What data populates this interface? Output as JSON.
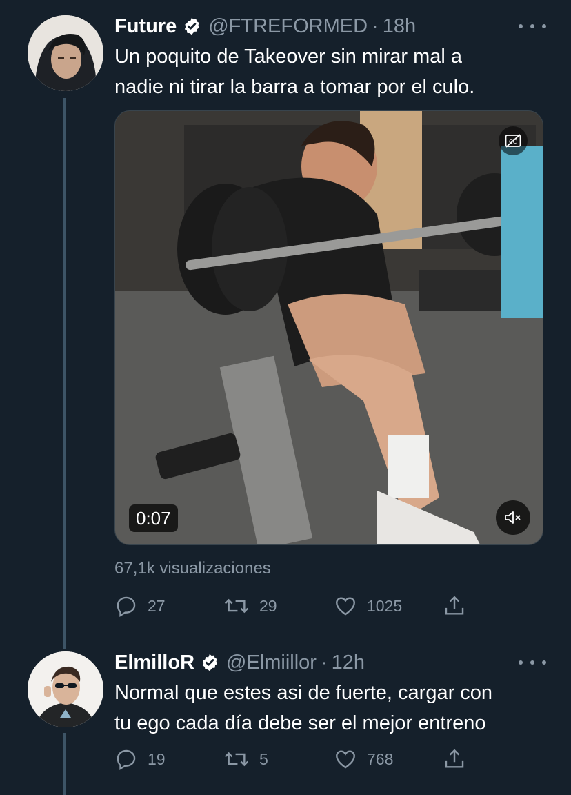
{
  "tweets": [
    {
      "display_name": "Future",
      "handle": "@FTREFORMED",
      "separator": "·",
      "time": "18h",
      "text_lines": [
        "Un poquito de Takeover sin mirar mal a",
        "nadie ni tirar la barra a tomar por el culo."
      ],
      "media": {
        "type": "video",
        "duration": "0:07",
        "icons": [
          "closed-captions-off-icon",
          "mute-icon"
        ]
      },
      "views": "67,1k visualizaciones",
      "actions": {
        "reply_count": "27",
        "retweet_count": "29",
        "like_count": "1025"
      }
    },
    {
      "display_name": "ElmilloR",
      "handle": "@Elmiillor",
      "separator": "·",
      "time": "12h",
      "text_lines": [
        "Normal que estes asi de fuerte, cargar con",
        "tu ego cada día debe ser el mejor entreno"
      ],
      "actions": {
        "reply_count": "19",
        "retweet_count": "5",
        "like_count": "768"
      }
    }
  ],
  "colors": {
    "background": "#15202b",
    "primary_text": "#ffffff",
    "secondary_text": "#8b98a5",
    "thread_line": "#3d5466",
    "verified_badge": "#ffffff"
  }
}
